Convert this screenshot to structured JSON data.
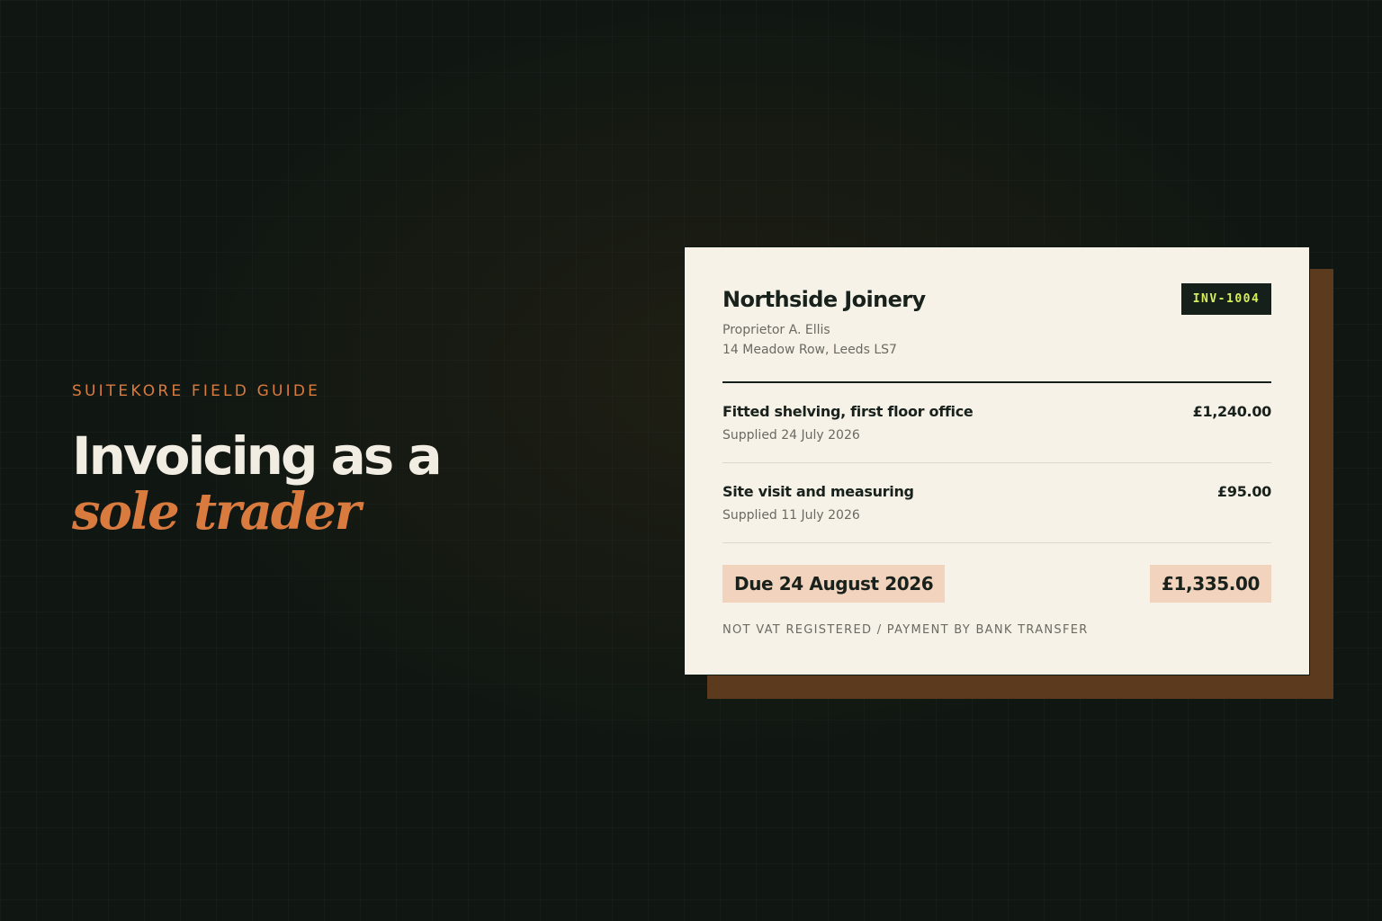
{
  "hero": {
    "eyebrow": "SUITEKORE FIELD GUIDE",
    "headline_line1": "Invoicing as a",
    "headline_line2": "sole trader"
  },
  "invoice": {
    "business_name": "Northside Joinery",
    "proprietor": "Proprietor A. Ellis",
    "address": "14 Meadow Row, Leeds LS7",
    "number": "INV-1004",
    "items": [
      {
        "description": "Fitted shelving, first floor office",
        "supplied": "Supplied 24 July 2026",
        "amount": "£1,240.00"
      },
      {
        "description": "Site visit and measuring",
        "supplied": "Supplied 11 July 2026",
        "amount": "£95.00"
      }
    ],
    "due": "Due 24 August 2026",
    "total": "£1,335.00",
    "footnote": "NOT VAT REGISTERED / PAYMENT BY BANK TRANSFER"
  },
  "colors": {
    "background": "#101712",
    "accent_orange": "#d97a3f",
    "card": "#f6f2e8",
    "card_shadow": "#5c3a1e",
    "badge_bg": "#16201a",
    "badge_text": "#d6ee5a",
    "highlight": "#f2d3bd"
  }
}
